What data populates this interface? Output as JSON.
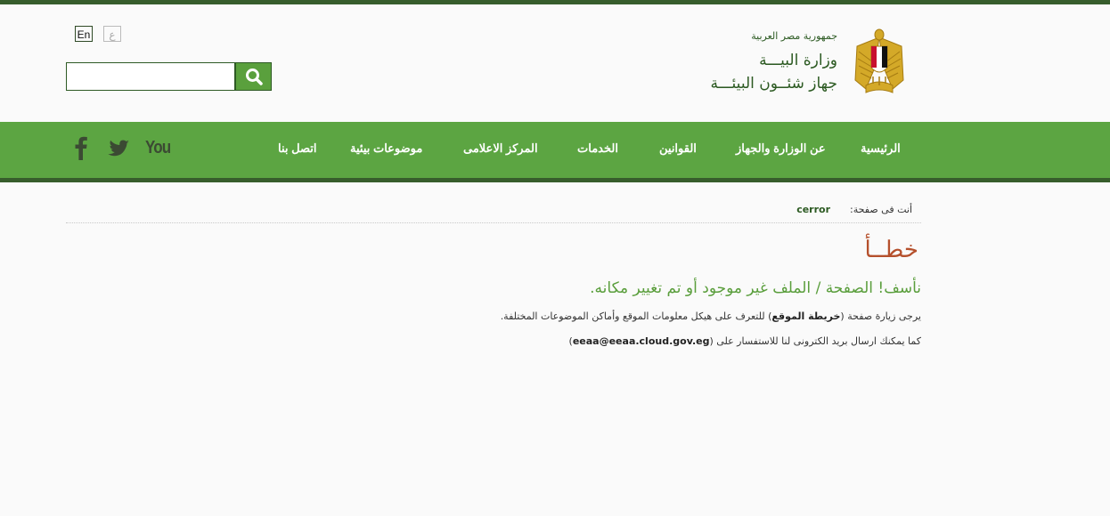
{
  "header": {
    "lang_en": "En",
    "lang_ar": "ع",
    "search_placeholder": "",
    "country": "جمهورية مصر العربية",
    "ministry": "وزارة البيـــة",
    "agency": "جهاز شئــون البيئـــة"
  },
  "nav": {
    "items": [
      "الرئيسية",
      "عن الوزارة والجهاز",
      "القوانين",
      "الخدمات",
      "المركز الاعلامى",
      "موضوعات بيئية",
      "اتصل بنا"
    ]
  },
  "social": {
    "facebook": "facebook-icon",
    "twitter": "twitter-icon",
    "youtube": "You"
  },
  "breadcrumb": {
    "label": "أنت فى صفحة:",
    "current": "cerror"
  },
  "error": {
    "title": "خطــأ",
    "subtitle": "نأسف! الصفحة / الملف غير موجود أو تم تغيير مكانه.",
    "line1_before": "يرجى زيارة صفحة (",
    "line1_link": "خريطة الموقع",
    "line1_after": ") للتعرف على هيكل معلومات الموقع وأماكن الموضوعات المختلفة.",
    "line2_before": "كما يمكنك ارسال بريد الكترونى لنا للاستفسار على (",
    "line2_link": "eeaa@eeaa.cloud.gov.eg",
    "line2_after": ")"
  },
  "colors": {
    "nav_green": "#5ca542",
    "dark_green": "#375d2c",
    "error_title": "#b5502c",
    "subtitle_green": "#5a9e3c"
  }
}
